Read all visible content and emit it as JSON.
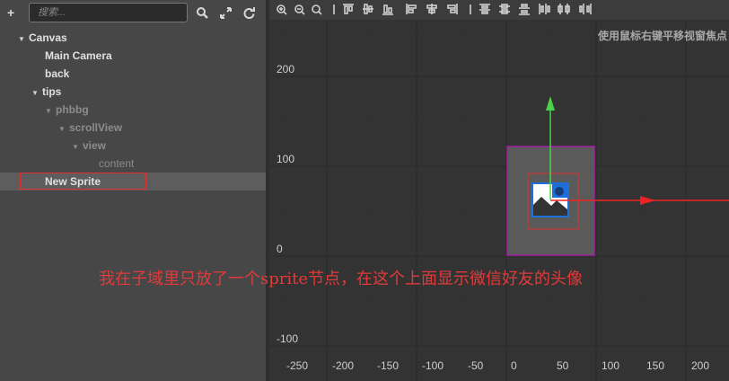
{
  "hierarchy": {
    "add_icon": "+",
    "search": {
      "placeholder": "搜索..."
    },
    "toolbar_icons": [
      "search-icon",
      "expand-icon",
      "refresh-icon"
    ],
    "nodes": [
      {
        "label": "Canvas",
        "arrow": "▼",
        "depth": 0
      },
      {
        "label": "Main Camera",
        "arrow": "",
        "depth": 1
      },
      {
        "label": "back",
        "arrow": "",
        "depth": 1
      },
      {
        "label": "tips",
        "arrow": "▼",
        "depth": 1
      },
      {
        "label": "phbbg",
        "arrow": "▼",
        "depth": 2
      },
      {
        "label": "scrollView",
        "arrow": "▼",
        "depth": 3
      },
      {
        "label": "view",
        "arrow": "▼",
        "depth": 4
      },
      {
        "label": "content",
        "arrow": "",
        "depth": 5
      },
      {
        "label": "New Sprite",
        "arrow": "",
        "depth": 1,
        "selected": true
      }
    ]
  },
  "scene": {
    "hint": "使用鼠标右键平移视窗焦点",
    "y_labels": [
      "200",
      "100",
      "0",
      "-100"
    ],
    "x_labels": [
      "-250",
      "-200",
      "-150",
      "-100",
      "-50",
      "0",
      "50",
      "100",
      "150",
      "200"
    ]
  },
  "annotation": "我在子域里只放了一个sprite节点，在这个上面显示微信好友的头像",
  "colors": {
    "panel": "#474747",
    "scene_bg": "#333333",
    "selection": "#5d5d5d",
    "highlight_red": "#e03030",
    "gizmo_green": "#4ad24a",
    "gizmo_red": "#ee2222",
    "node_border": "#a020a0"
  }
}
